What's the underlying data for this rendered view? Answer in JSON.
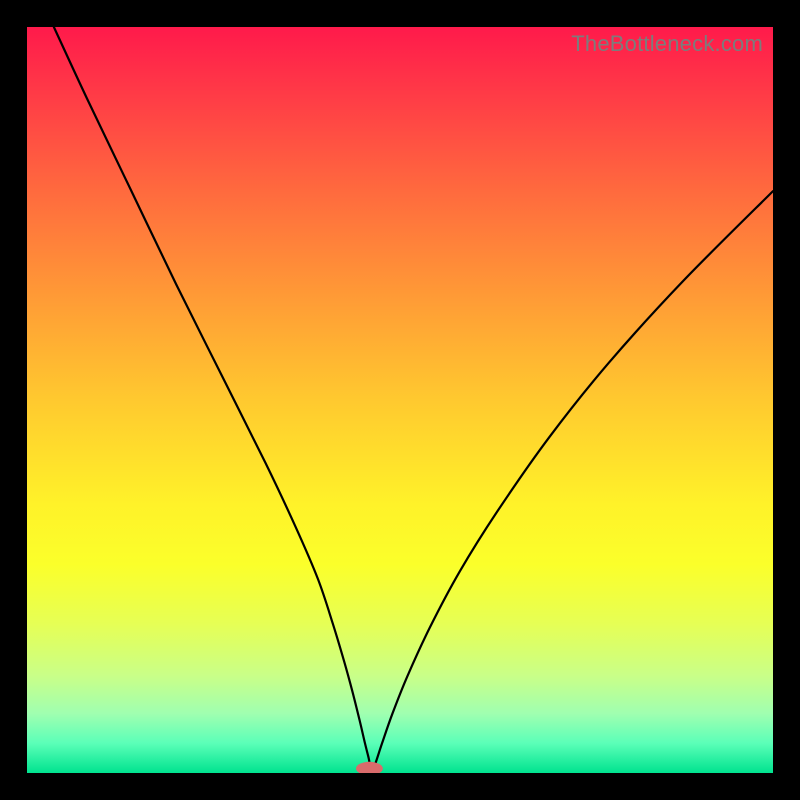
{
  "watermark": "TheBottleneck.com",
  "chart_data": {
    "type": "line",
    "title": "",
    "xlabel": "",
    "ylabel": "",
    "xlim": [
      0,
      100
    ],
    "ylim": [
      0,
      100
    ],
    "series": [
      {
        "name": "curve",
        "x": [
          3.6,
          8,
          14,
          20,
          26,
          32,
          36,
          39,
          41,
          42.5,
          43.6,
          44.6,
          45.3,
          45.8,
          46,
          46.3,
          46.6,
          47.6,
          49,
          51,
          54,
          58,
          63,
          70,
          78,
          88,
          100
        ],
        "y": [
          100,
          90.5,
          78,
          65.5,
          53.5,
          41.5,
          33,
          26,
          20,
          15,
          11,
          7,
          4,
          2,
          1,
          0.8,
          1,
          4,
          8,
          13,
          19.5,
          27,
          35,
          45,
          55,
          66,
          78
        ]
      }
    ],
    "marker": {
      "x": 45.9,
      "y": 0.6,
      "rx": 1.8,
      "ry": 0.9,
      "color": "#d96b6b"
    },
    "gradient_stops": [
      {
        "pct": 0,
        "color": "#ff1a4b"
      },
      {
        "pct": 50,
        "color": "#ffe529"
      },
      {
        "pct": 100,
        "color": "#00e38f"
      }
    ]
  }
}
